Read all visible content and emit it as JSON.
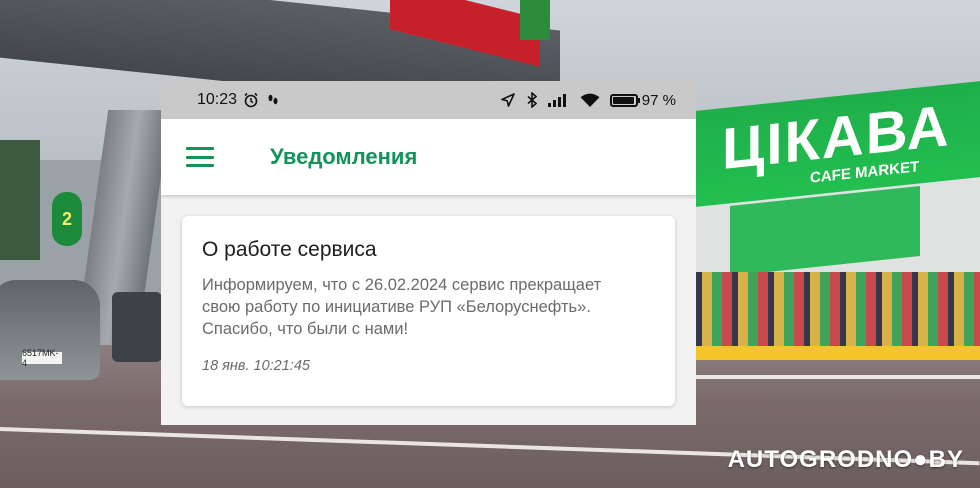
{
  "status_bar": {
    "time": "10:23",
    "battery_percent_label": "97 %",
    "battery_level": 0.97,
    "icons": [
      "alarm-icon",
      "step-counter-icon",
      "location-icon",
      "bluetooth-icon",
      "signal-icon",
      "wifi-icon",
      "battery-icon"
    ]
  },
  "app_bar": {
    "title": "Уведомления",
    "menu_icon": "hamburger-menu-icon"
  },
  "notifications": [
    {
      "title": "О работе сервиса",
      "body": "Информируем, что с 26.02.2024 сервис прекращает свою работу по инициативе РУП «Белоруснефть». Спасибо, что были с нами!",
      "timestamp": "18 янв. 10:21:45"
    }
  ],
  "background_photo": {
    "store_sign": "ЦIКАВА",
    "store_subsign": "CAFE MARKET",
    "pump_number": "2",
    "car_plate": "6517MK-4"
  },
  "watermark": "AUTOGRODNO●BY",
  "colors": {
    "accent": "#12935a",
    "status_bar_bg": "#c9c9c9",
    "screen_bg": "#f2f2f2",
    "card_bg": "#ffffff",
    "body_text": "#6b6b6b"
  }
}
